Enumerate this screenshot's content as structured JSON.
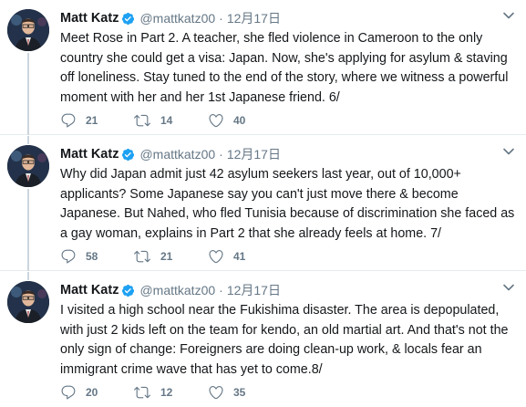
{
  "tweets": [
    {
      "name": "Matt Katz",
      "handle": "@mattkatz00",
      "separator": "·",
      "date": "12月17日",
      "text": "Meet Rose in Part 2. A teacher, she fled violence in Cameroon to the only country she could get a visa: Japan. Now, she's applying for asylum & staving off loneliness. Stay tuned to the end of the story, where we witness a powerful moment with her and her 1st Japanese friend. 6/",
      "replies": "21",
      "retweets": "14",
      "likes": "40"
    },
    {
      "name": "Matt Katz",
      "handle": "@mattkatz00",
      "separator": "·",
      "date": "12月17日",
      "text": "Why did Japan admit just 42 asylum seekers last year, out of 10,000+ applicants? Some Japanese say you can't just move there & become Japanese. But Nahed, who fled Tunisia because of discrimination she faced as a gay woman, explains in Part 2 that she already feels at home. 7/",
      "replies": "58",
      "retweets": "21",
      "likes": "41"
    },
    {
      "name": "Matt Katz",
      "handle": "@mattkatz00",
      "separator": "·",
      "date": "12月17日",
      "text": "I visited a high school near the Fukishima disaster. The area is depopulated, with just 2 kids left on the team for kendo, an old martial art. And that's not the only sign of change: Foreigners are doing clean-up work, & locals fear an immigrant crime wave that has yet to come.8/",
      "replies": "20",
      "retweets": "12",
      "likes": "35"
    }
  ],
  "icons": {
    "verified": "verified-badge-icon",
    "reply": "reply-icon",
    "retweet": "retweet-icon",
    "like": "heart-icon",
    "more": "chevron-down-icon",
    "avatar": "profile-photo"
  },
  "colors": {
    "verified": "#1da1f2",
    "icon_gray": "#657786",
    "thread_line": "#ccd6dd",
    "text": "#14171a"
  }
}
